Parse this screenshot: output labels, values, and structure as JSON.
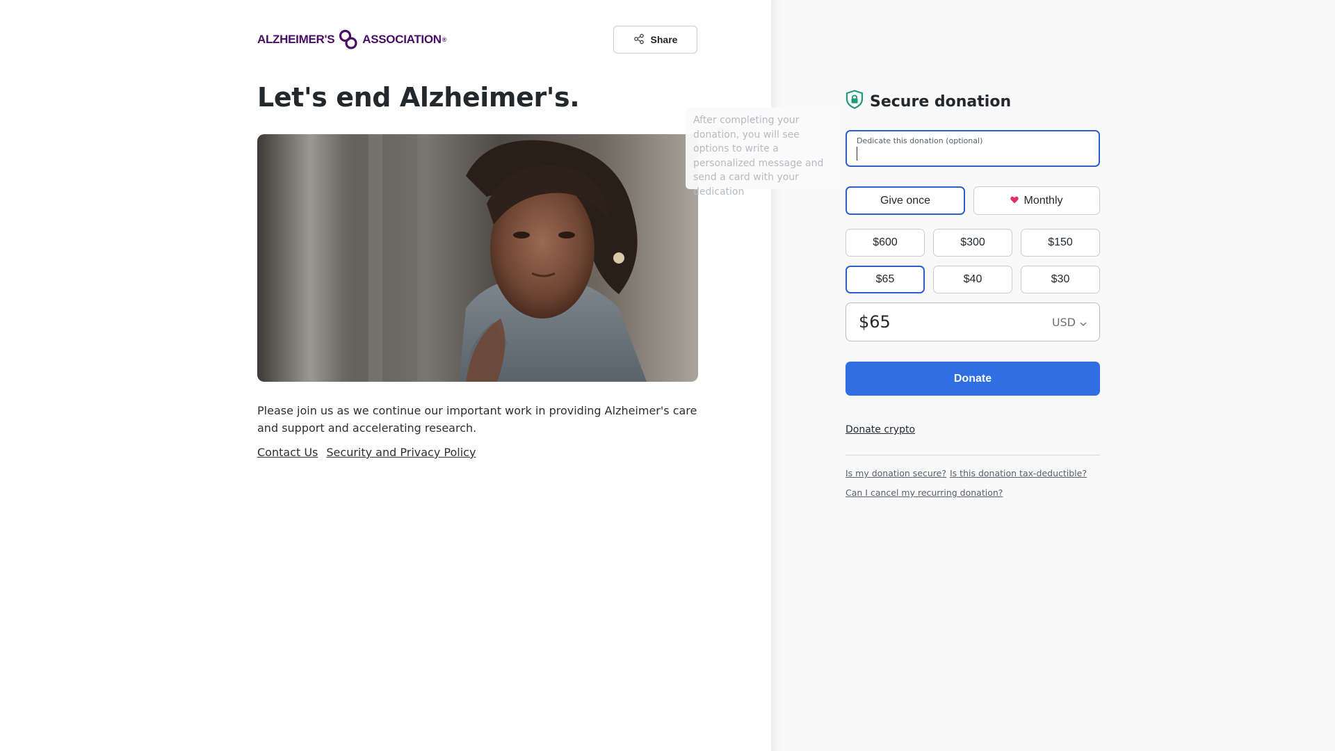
{
  "header": {
    "logo_left": "ALZHEIMER'S",
    "logo_right": "ASSOCIATION",
    "logo_reg": "®",
    "share_label": "Share"
  },
  "main": {
    "headline": "Let's end Alzheimer's.",
    "body": "Please join us as we continue our important work in providing Alzheimer's care and support and accelerating research.",
    "links": [
      "Contact Us",
      "Security and Privacy Policy"
    ]
  },
  "tooltip": {
    "text": "After completing your donation, you will see options to write a personalized message and send a card with your dedication"
  },
  "donation": {
    "title": "Secure donation",
    "dedicate_label": "Dedicate this donation (optional)",
    "dedicate_value": "",
    "frequency": {
      "once": "Give once",
      "monthly": "Monthly",
      "selected": "once"
    },
    "amounts": [
      "$600",
      "$300",
      "$150",
      "$65",
      "$40",
      "$30"
    ],
    "selected_amount": "$65",
    "amount_value": "$65",
    "currency": "USD",
    "donate_label": "Donate",
    "crypto_label": "Donate crypto",
    "faq": [
      "Is my donation secure?",
      "Is this donation tax-deductible?",
      "Can I cancel my recurring donation?"
    ]
  },
  "colors": {
    "accent": "#2f6ee3",
    "selected_border": "#2a5fcc",
    "brand_purple": "#4a0d66",
    "shield_green": "#1f9a7a",
    "heart_pink": "#e0306a"
  },
  "icons": {
    "share": "share-icon",
    "shield": "shield-lock-icon",
    "heart": "heart-icon",
    "chevron": "chevron-down-icon"
  }
}
